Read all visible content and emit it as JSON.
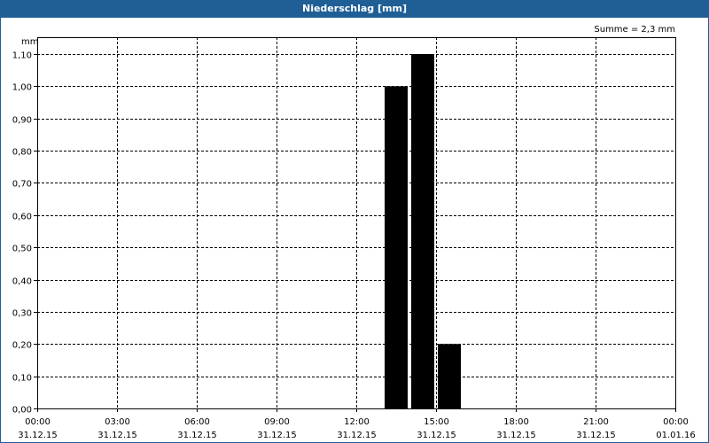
{
  "window": {
    "title": "Niederschlag [mm]"
  },
  "summary": {
    "label": "Summe = 2,3 mm"
  },
  "chart_data": {
    "type": "bar",
    "title": "Niederschlag [mm]",
    "ylabel": "mm",
    "xlabel": "",
    "ylim": [
      0,
      1.1
    ],
    "x_range_hours": [
      0,
      24
    ],
    "grid": true,
    "bar_color": "#000000",
    "y_ticks": [
      "0,00",
      "0,10",
      "0,20",
      "0,30",
      "0,40",
      "0,50",
      "0,60",
      "0,70",
      "0,80",
      "0,90",
      "1,00",
      "1,10"
    ],
    "x_ticks": [
      {
        "time": "00:00",
        "date": "31.12.15"
      },
      {
        "time": "03:00",
        "date": "31.12.15"
      },
      {
        "time": "06:00",
        "date": "31.12.15"
      },
      {
        "time": "09:00",
        "date": "31.12.15"
      },
      {
        "time": "12:00",
        "date": "31.12.15"
      },
      {
        "time": "15:00",
        "date": "31.12.15"
      },
      {
        "time": "18:00",
        "date": "31.12.15"
      },
      {
        "time": "21:00",
        "date": "31.12.15"
      },
      {
        "time": "00:00",
        "date": "01.01.16"
      }
    ],
    "bars": [
      {
        "start": "13:00",
        "end": "14:00",
        "value": 1.0
      },
      {
        "start": "14:00",
        "end": "15:00",
        "value": 1.1
      },
      {
        "start": "15:00",
        "end": "16:00",
        "value": 0.2
      }
    ]
  }
}
